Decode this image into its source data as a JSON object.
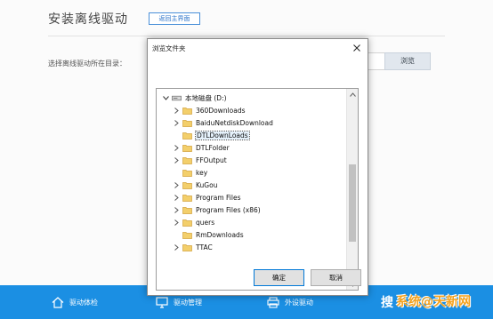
{
  "app": {
    "title": "安装离线驱动",
    "back_button": "返回主界面",
    "dir_label": "选择离线驱动所在目录：",
    "browse_button": "浏览"
  },
  "bottom_nav": [
    {
      "label": "驱动体检",
      "icon": "home-icon"
    },
    {
      "label": "驱动管理",
      "icon": "monitor-icon"
    },
    {
      "label": "外设驱动",
      "icon": "printer-icon"
    },
    {
      "label": "搜",
      "icon": "more-icon"
    }
  ],
  "dialog": {
    "title": "浏览文件夹",
    "ok_button": "确定",
    "cancel_button": "取消"
  },
  "tree": {
    "root": {
      "label": "本地磁盘 (D:)",
      "icon": "drive-icon",
      "expanded": true
    },
    "folders": [
      {
        "label": "360Downloads",
        "has_children": true,
        "selected": false
      },
      {
        "label": "BaiduNetdiskDownload",
        "has_children": true,
        "selected": false
      },
      {
        "label": "DTLDownLoads",
        "has_children": false,
        "selected": true
      },
      {
        "label": "DTLFolder",
        "has_children": true,
        "selected": false
      },
      {
        "label": "FFOutput",
        "has_children": true,
        "selected": false
      },
      {
        "label": "key",
        "has_children": false,
        "selected": false
      },
      {
        "label": "KuGou",
        "has_children": true,
        "selected": false
      },
      {
        "label": "Program Files",
        "has_children": true,
        "selected": false
      },
      {
        "label": "Program Files (x86)",
        "has_children": true,
        "selected": false
      },
      {
        "label": "quers",
        "has_children": true,
        "selected": false
      },
      {
        "label": "RmDownloads",
        "has_children": false,
        "selected": false
      },
      {
        "label": "TTAC",
        "has_children": true,
        "selected": false
      }
    ]
  },
  "watermark": "系统@天新网",
  "colors": {
    "accent_blue": "#1b8fe3",
    "folder_yellow": "#f3cf6b",
    "selection": "#e5f1fb",
    "watermark_orange": "#f5a11c"
  }
}
